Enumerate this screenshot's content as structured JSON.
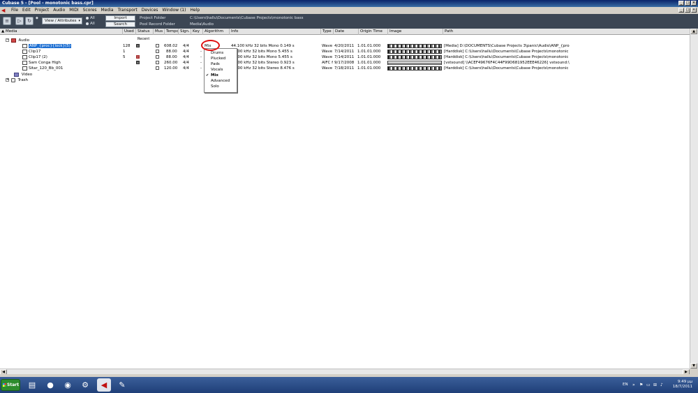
{
  "window": {
    "title": "Cubase 5 - [Pool - monotonic bass.cpr]",
    "buttons": [
      "_",
      "□",
      "×"
    ]
  },
  "menubar": {
    "items": [
      "File",
      "Edit",
      "Project",
      "Audio",
      "MIDI",
      "Scores",
      "Media",
      "Transport",
      "Devices",
      "Window (1)",
      "Help"
    ]
  },
  "toolbar": {
    "view_label": "View / Attributes",
    "radio_all_1": "All",
    "radio_all_2": "All",
    "import_label": "Import",
    "search_label": "Search",
    "project_folder_label": "Project Folder",
    "pool_record_label": "Pool Record Folder",
    "project_folder_value": "C:\\Users\\hallu\\Documents\\Cubase Projects\\monotonic bass",
    "pool_record_value": "Media\\Audio"
  },
  "columns": {
    "media": "Media",
    "used": "Used",
    "status": "Status",
    "mus": "Mus",
    "tempo": "Tempo",
    "sign": "Sign.",
    "key": "Key",
    "algorithm": "Algorithm",
    "info": "Info",
    "type": "Type",
    "date": "Date",
    "origin": "Origin Time",
    "image": "Image",
    "path": "Path"
  },
  "recent_label": "Recent",
  "tree": {
    "audio": "Audio",
    "video": "Video",
    "trash": "Trash"
  },
  "rows": [
    {
      "name": "ANP_{proc}{lock}(5)",
      "used": "128",
      "status": "x",
      "tempo": "608.02",
      "sign": "4/4",
      "key": "",
      "algorithm": "Mix",
      "info": "44.100 kHz  32 bits  Mono  0.149 s",
      "type": "Wave",
      "date": "4/20/2011",
      "origin": "1.01.01.000",
      "path": "[Media] D:\\DOCUMENTS\\Cubase Projects 3\\panic\\Audio\\ANP_{proc}{",
      "selected": true
    },
    {
      "name": "Clip17",
      "used": "1",
      "status": "",
      "tempo": "88.00",
      "sign": "4/4",
      "key": "-",
      "algorithm": "",
      "info": "100 kHz  32 bits  Mono  5.455 s",
      "type": "Wave",
      "date": "7/14/2011",
      "origin": "1.01.01.000",
      "path": "[Harddisk] C:\\Users\\hallu\\Documents\\Cubase Projects\\monotonic bass\\",
      "selected": false
    },
    {
      "name": "Clip17 (2)",
      "used": "5",
      "status": "r",
      "tempo": "88.00",
      "sign": "4/4",
      "key": "-",
      "algorithm": "",
      "info": "100 kHz  32 bits  Mono  5.455 s",
      "type": "Wave",
      "date": "7/14/2011",
      "origin": "1.01.01.000",
      "path": "[Harddisk] C:\\Users\\hallu\\Documents\\Cubase Projects\\monotonic bass\\",
      "selected": false
    },
    {
      "name": "Sam Conga High",
      "used": "",
      "status": "x",
      "tempo": "260.00",
      "sign": "4/4",
      "key": "-",
      "algorithm": "",
      "info": "100 kHz  32 bits  Stereo  0.923 s",
      "type": "AIFC f",
      "date": "9/17/2008",
      "origin": "1.01.01.000",
      "path": "[vstsound] \\\\ACEF49676F4C44F99D681952EEE46226] vstsound:\\\\acef",
      "selected": false
    },
    {
      "name": "Sitar_120_Bb_001",
      "used": "",
      "status": "",
      "tempo": "120.00",
      "sign": "4/4",
      "key": "-",
      "algorithm": "",
      "info": "100 kHz  32 bits  Stereo  8.476 s",
      "type": "Wave",
      "date": "7/18/2011",
      "origin": "1.01.01.000",
      "path": "[Harddisk] C:\\Users\\hallu\\Documents\\Cubase Projects\\monotonic bass\\",
      "selected": false
    }
  ],
  "algorithm_menu": {
    "items": [
      "Drums",
      "Plucked",
      "Pads",
      "Vocals",
      "Mix",
      "Advanced",
      "Solo"
    ],
    "checked": "Mix"
  },
  "taskbar": {
    "start_label": "Start",
    "language": "EN",
    "time": "9:49 μμ",
    "date": "18/7/2011"
  }
}
